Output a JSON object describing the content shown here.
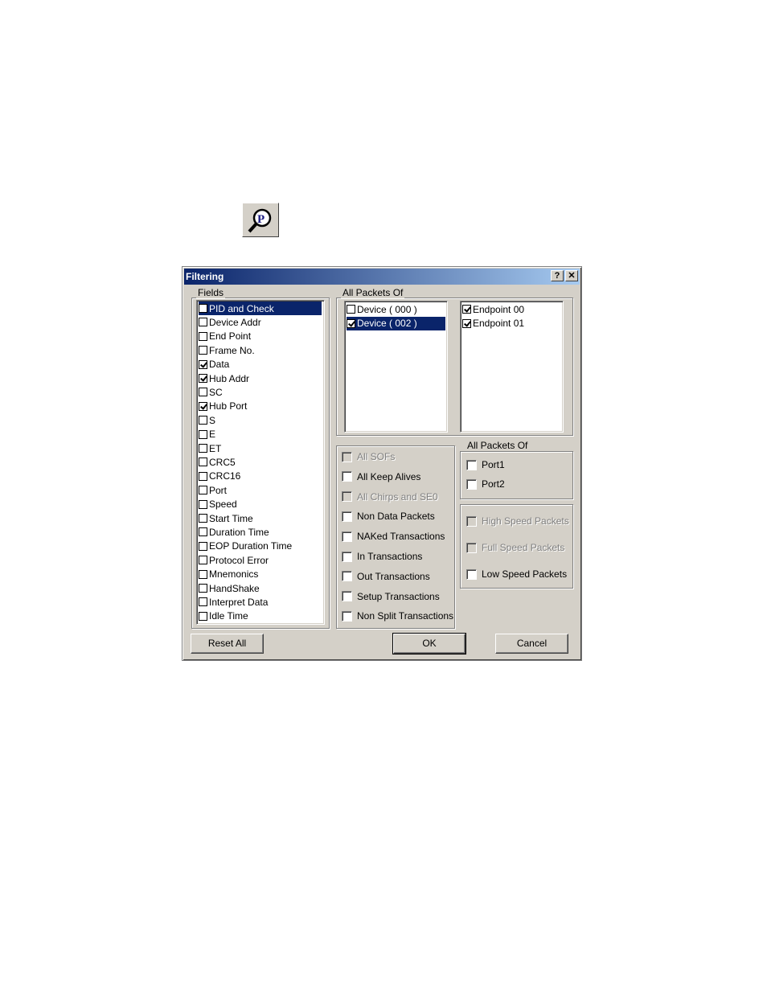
{
  "dialog": {
    "title": "Filtering",
    "help_label": "?",
    "close_label": "✕"
  },
  "fields": {
    "legend": "Fields",
    "items": [
      {
        "label": "PID and Check",
        "checked": false,
        "selected": true
      },
      {
        "label": "Device Addr",
        "checked": false
      },
      {
        "label": "End Point",
        "checked": false
      },
      {
        "label": "Frame No.",
        "checked": false
      },
      {
        "label": "Data",
        "checked": true
      },
      {
        "label": "Hub Addr",
        "checked": true
      },
      {
        "label": "SC",
        "checked": false
      },
      {
        "label": "Hub Port",
        "checked": true
      },
      {
        "label": "S",
        "checked": false
      },
      {
        "label": "E",
        "checked": false
      },
      {
        "label": "ET",
        "checked": false
      },
      {
        "label": "CRC5",
        "checked": false
      },
      {
        "label": "CRC16",
        "checked": false
      },
      {
        "label": "Port",
        "checked": false
      },
      {
        "label": "Speed",
        "checked": false
      },
      {
        "label": "Start Time",
        "checked": false
      },
      {
        "label": "Duration Time",
        "checked": false
      },
      {
        "label": "EOP Duration Time",
        "checked": false
      },
      {
        "label": "Protocol Error",
        "checked": false
      },
      {
        "label": "Mnemonics",
        "checked": false
      },
      {
        "label": "HandShake",
        "checked": false
      },
      {
        "label": "Interpret Data",
        "checked": false
      },
      {
        "label": "Idle Time",
        "checked": false
      }
    ]
  },
  "packets_of_devices": {
    "legend": "All Packets Of",
    "devices": [
      {
        "label": "Device ( 000 )",
        "checked": false
      },
      {
        "label": "Device ( 002 )",
        "checked": true,
        "selected": true
      }
    ],
    "endpoints": [
      {
        "label": "Endpoint 00",
        "checked": true
      },
      {
        "label": "Endpoint 01",
        "checked": true
      }
    ]
  },
  "transactions": {
    "items": [
      {
        "label": "All SOFs",
        "disabled": true
      },
      {
        "label": "All Keep Alives",
        "disabled": false
      },
      {
        "label": "All Chirps and SE0",
        "disabled": true
      },
      {
        "label": "Non Data Packets",
        "disabled": false
      },
      {
        "label": "NAKed Transactions",
        "disabled": false
      },
      {
        "label": "In Transactions",
        "disabled": false
      },
      {
        "label": "Out Transactions",
        "disabled": false
      },
      {
        "label": "Setup Transactions",
        "disabled": false
      },
      {
        "label": "Non Split Transactions",
        "disabled": false
      }
    ]
  },
  "ports": {
    "legend": "All Packets Of",
    "items": [
      {
        "label": "Port1"
      },
      {
        "label": "Port2"
      }
    ]
  },
  "speeds": {
    "items": [
      {
        "label": "High Speed Packets",
        "disabled": true
      },
      {
        "label": "Full Speed Packets",
        "disabled": true
      },
      {
        "label": "Low Speed Packets",
        "disabled": false
      }
    ]
  },
  "buttons": {
    "reset": "Reset All",
    "ok": "OK",
    "cancel": "Cancel"
  }
}
